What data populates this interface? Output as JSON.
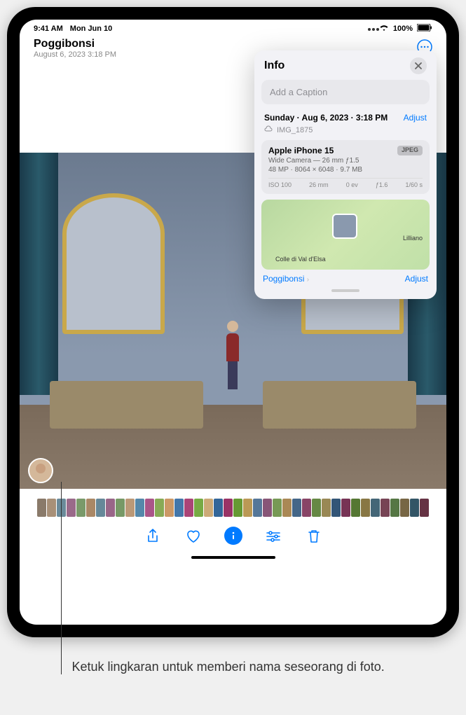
{
  "status": {
    "time": "9:41 AM",
    "date": "Mon Jun 10",
    "battery": "100%"
  },
  "header": {
    "title": "Poggibonsi",
    "subtitle": "August 6, 2023  3:18 PM"
  },
  "info": {
    "title": "Info",
    "caption_placeholder": "Add a Caption",
    "date_line": "Sunday · Aug 6, 2023 · 3:18 PM",
    "adjust_label": "Adjust",
    "filename": "IMG_1875",
    "device": "Apple iPhone 15",
    "format_badge": "JPEG",
    "lens": "Wide Camera — 26 mm ƒ1.5",
    "specs": "48 MP · 8064 × 6048 · 9.7 MB",
    "exif": {
      "iso": "ISO 100",
      "focal": "26 mm",
      "ev": "0 ev",
      "aperture": "ƒ1.6",
      "shutter": "1/60 s"
    },
    "map": {
      "place1": "Colle di Val d'Elsa",
      "place2": "Lilliano",
      "location_link": "Poggibonsi",
      "adjust_label": "Adjust"
    }
  },
  "caption_callout": "Ketuk lingkaran untuk memberi nama seseorang di foto.",
  "thumb_colors": [
    "#8a7a6a",
    "#a89078",
    "#6a8a9a",
    "#9a6a8a",
    "#7a9a6a",
    "#aa8866",
    "#668899",
    "#996688",
    "#779966",
    "#bb9977",
    "#5588aa",
    "#aa5588",
    "#88aa55",
    "#cc9966",
    "#4477aa",
    "#aa4477",
    "#77aa44",
    "#ccaa77",
    "#336699",
    "#993366",
    "#669933",
    "#bb9955",
    "#557799",
    "#885577",
    "#779955",
    "#aa8855",
    "#446688",
    "#884466",
    "#668844",
    "#998855",
    "#335577",
    "#773355",
    "#557733",
    "#887744",
    "#446677",
    "#774455",
    "#557744",
    "#776644",
    "#335566",
    "#663344"
  ]
}
